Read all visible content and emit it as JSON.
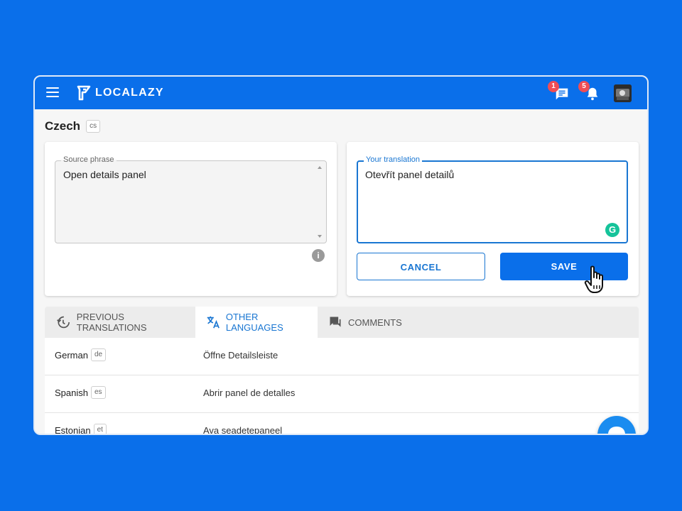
{
  "app": {
    "logo_text": "LOCALAZY"
  },
  "header": {
    "messages_badge": "1",
    "notifications_badge": "5"
  },
  "language": {
    "name": "Czech",
    "code": "cs"
  },
  "source": {
    "legend": "Source phrase",
    "text": "Open details panel"
  },
  "translation": {
    "legend": "Your translation",
    "text": "Otevřít panel detailů"
  },
  "actions": {
    "cancel": "CANCEL",
    "save": "SAVE"
  },
  "tabs": [
    {
      "label": "PREVIOUS TRANSLATIONS"
    },
    {
      "label": "OTHER LANGUAGES"
    },
    {
      "label": "COMMENTS"
    }
  ],
  "rows": [
    {
      "language": "German",
      "code": "de",
      "translation": "Öffne Detailsleiste"
    },
    {
      "language": "Spanish",
      "code": "es",
      "translation": "Abrir panel de detalles"
    },
    {
      "language": "Estonian",
      "code": "et",
      "translation": "Ava seadetepaneel"
    }
  ],
  "colors": {
    "primary": "#0a6fea",
    "accent": "#1976d2",
    "badge": "#ef4d55",
    "grammarly": "#15c39a"
  }
}
